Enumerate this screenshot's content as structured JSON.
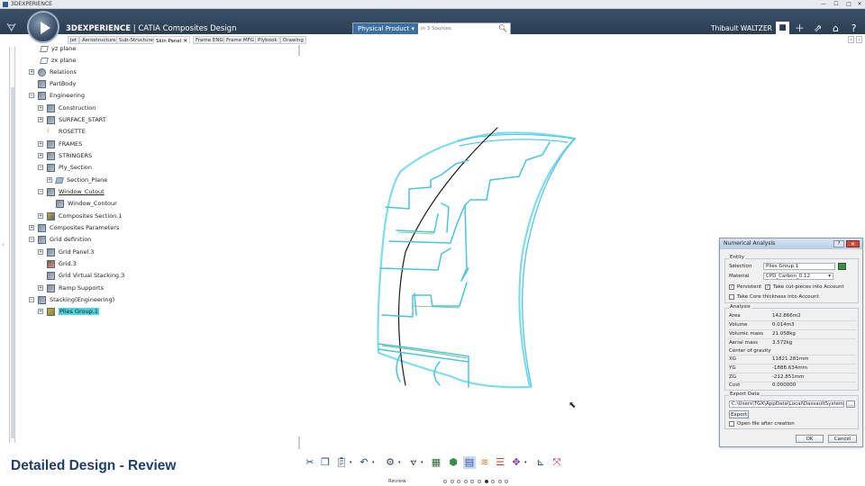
{
  "os_window": {
    "title": "3DEXPERIENCE",
    "buttons": [
      "—",
      "☐",
      "□",
      "✕"
    ]
  },
  "app": {
    "brand": "3DEXPERIENCE | CATIA",
    "brand_bold": "3DEXPERIENCE",
    "brand_rest": " | CATIA",
    "app_name": "Composites Design",
    "search_scope": "Physical Product",
    "search_placeholder": "in 3 Sources",
    "user_name": "Thibault WALTZER"
  },
  "tabs": [
    {
      "label": "Jet",
      "active": false
    },
    {
      "label": "Aerostructure",
      "active": false
    },
    {
      "label": "Sub-Structure",
      "active": false
    },
    {
      "label": "Skin Panel",
      "active": true
    },
    {
      "label": "Frame ENG",
      "active": false
    },
    {
      "label": "Frame MFG",
      "active": false
    },
    {
      "label": "Plybook",
      "active": false
    },
    {
      "label": "Drawing",
      "active": false
    }
  ],
  "tree": [
    {
      "label": "yz plane",
      "icon": "plane-icon"
    },
    {
      "label": "zx plane",
      "icon": "plane-icon"
    },
    {
      "label": "Relations",
      "icon": "relations-icon"
    },
    {
      "label": "PartBody",
      "icon": "partbody-icon"
    },
    {
      "label": "Engineering",
      "icon": "engineering-icon"
    },
    {
      "label": "Construction",
      "icon": "geometric-set-icon"
    },
    {
      "label": "SURFACE_START",
      "icon": "geometric-set-icon"
    },
    {
      "label": "ROSETTE",
      "icon": "rosette-icon"
    },
    {
      "label": "FRAMES",
      "icon": "geometric-set-icon"
    },
    {
      "label": "STRINGERS",
      "icon": "geometric-set-icon"
    },
    {
      "label": "Ply_Section",
      "icon": "geometric-set-icon"
    },
    {
      "label": "Section_Plane",
      "icon": "plane-icon"
    },
    {
      "label": "Window_Cutout",
      "icon": "cutout-icon",
      "underline": true
    },
    {
      "label": "Window_Contour",
      "icon": "contour-icon"
    },
    {
      "label": "Composites Section.1",
      "icon": "composites-section-icon"
    },
    {
      "label": "Composites Parameters",
      "icon": "parameters-icon"
    },
    {
      "label": "Grid definition",
      "icon": "grid-icon"
    },
    {
      "label": "Grid Panel.3",
      "icon": "grid-panel-icon"
    },
    {
      "label": "Grid.3",
      "icon": "grid-icon"
    },
    {
      "label": "Grid Virtual Stacking.3",
      "icon": "virtual-stacking-icon"
    },
    {
      "label": "Ramp Supports",
      "icon": "ramp-icon"
    },
    {
      "label": "Stacking(Engineering)",
      "icon": "stacking-icon"
    },
    {
      "label": "Plies Group.1",
      "icon": "plies-group-icon",
      "selected": true
    }
  ],
  "dialog": {
    "title": "Numerical Analysis",
    "entity_group": "Entity",
    "selection_label": "Selection",
    "selection_value": "Plies Group.1",
    "material_label": "Material",
    "material_value": "CPD_Carbon_0.12",
    "persistent_label": "Persistent",
    "cut_pieces_label": "Take cut-pieces into Account",
    "core_thickness_label": "Take Core thickness into Account",
    "analysis_group": "Analysis",
    "rows": [
      {
        "label": "Area",
        "value": "142.866m2"
      },
      {
        "label": "Volume",
        "value": "0.014m3"
      },
      {
        "label": "Volumic mass",
        "value": "21.058kg"
      },
      {
        "label": "Aerial mass",
        "value": "3.572kg"
      },
      {
        "label": "Center of gravity",
        "value": ""
      },
      {
        "label": "XG",
        "value": "11821.281mm"
      },
      {
        "label": "YG",
        "value": "-1888.634mm"
      },
      {
        "label": "ZG",
        "value": "-212.851mm"
      },
      {
        "label": "Cost",
        "value": "0.000000"
      }
    ],
    "export_group": "Export Data",
    "export_path": "C:\\Users\\TGX\\AppData\\Local\\DassaultSystemes\\",
    "export_button": "Export",
    "open_after_label": "Open file after creation",
    "ok": "OK",
    "cancel": "Cancel"
  },
  "caption": "Detailed Design - Review",
  "toolbar_section": "Review",
  "pager": {
    "count": 10,
    "active": 7
  },
  "colors": {
    "header": "#2f4459",
    "accent": "#3d6f9f",
    "selection": "#4fd3dc",
    "ply_edge": "#4fc9de",
    "caption": "#1e3f6d"
  }
}
